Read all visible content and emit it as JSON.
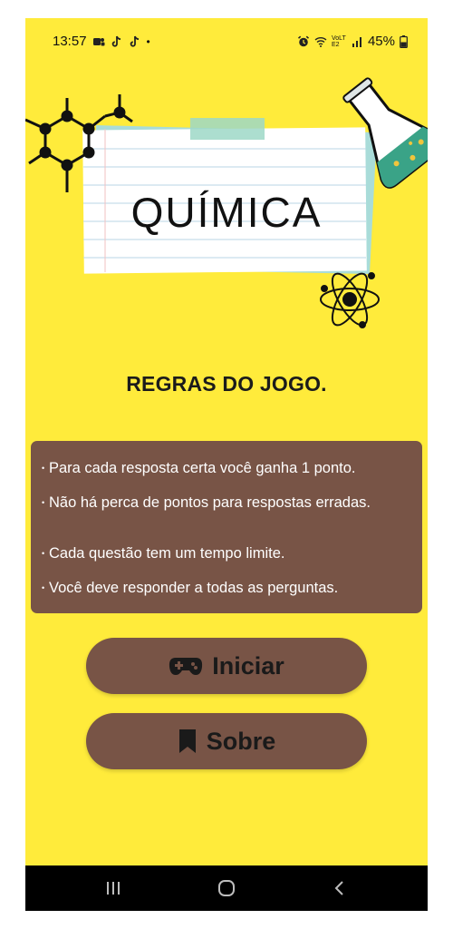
{
  "status_bar": {
    "time": "13:57",
    "dot": "•",
    "battery": "45%",
    "network_label": "VoLTE2",
    "icons": [
      "teams-icon",
      "tiktok-icon",
      "tiktok-icon",
      "alarm-icon",
      "wifi-icon",
      "signal-icon",
      "battery-icon"
    ]
  },
  "hero": {
    "title": "QUÍMICA",
    "decorations": [
      "molecule-icon",
      "flask-icon",
      "atom-icon",
      "notepaper-card",
      "tape-strip"
    ]
  },
  "rules": {
    "heading": "REGRAS DO JOGO.",
    "bullet": "•",
    "items": [
      "Para cada resposta certa você ganha 1 ponto.",
      "Não há perca de pontos para respostas erradas.",
      "Cada questão tem um tempo limite.",
      "Você deve responder a todas as perguntas."
    ]
  },
  "buttons": {
    "start": {
      "label": "Iniciar",
      "icon": "gamepad-icon"
    },
    "about": {
      "label": "Sobre",
      "icon": "bookmark-icon"
    }
  },
  "navbar": {
    "items": [
      "recent-apps-icon",
      "home-icon",
      "back-icon"
    ]
  },
  "colors": {
    "background": "#ffeb3b",
    "panel": "#785446",
    "text_dark": "#1b1b1b",
    "navbar": "#000000"
  }
}
